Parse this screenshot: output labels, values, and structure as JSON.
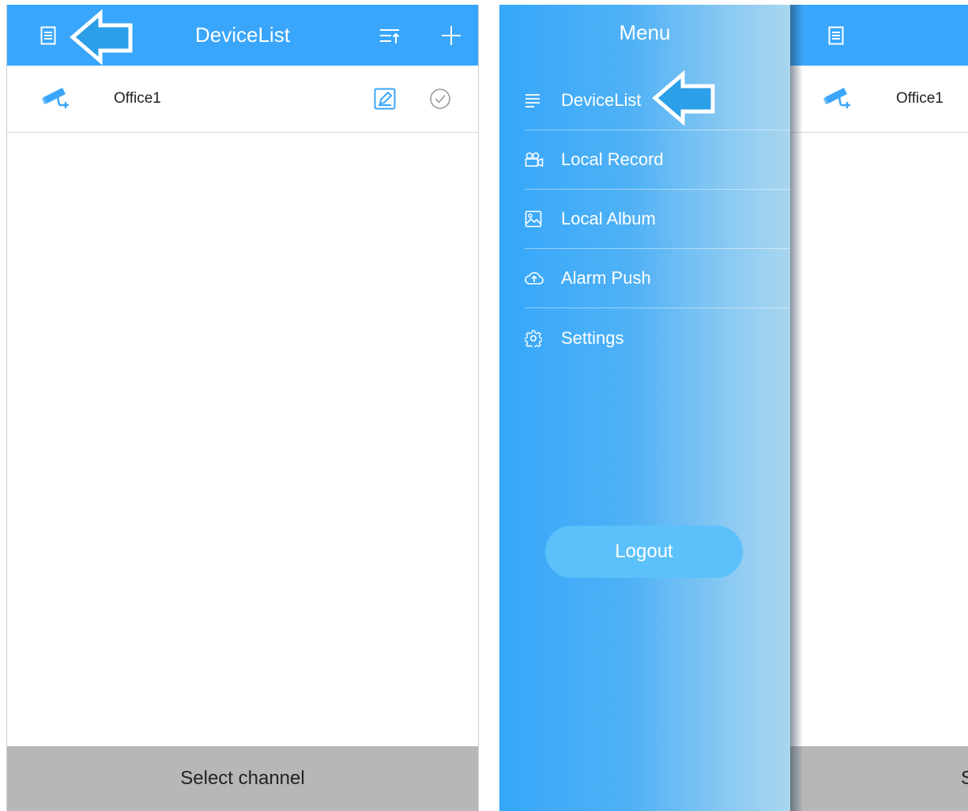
{
  "left_screen": {
    "title": "DeviceList",
    "device": {
      "name": "Office1"
    },
    "bottom_label": "Select channel",
    "icons": {
      "menu": "menu-document-icon",
      "sort": "sort-list-icon",
      "add": "plus-icon",
      "camera": "camera-icon",
      "edit": "edit-pencil-icon",
      "check": "check-circle-icon"
    }
  },
  "right_screen": {
    "menu_title": "Menu",
    "menu_items": [
      {
        "label": "DeviceList",
        "icon": "list-lines-icon"
      },
      {
        "label": "Local Record",
        "icon": "video-camera-icon"
      },
      {
        "label": "Local Album",
        "icon": "image-icon"
      },
      {
        "label": "Alarm Push",
        "icon": "cloud-upload-icon"
      },
      {
        "label": "Settings",
        "icon": "gear-icon"
      }
    ],
    "logout_label": "Logout",
    "device": {
      "name": "Office1"
    },
    "bottom_label_partial": "S"
  },
  "colors": {
    "accent": "#3aa6fb",
    "arrow": "#2b9fe8",
    "bottom_bar": "#b7b7b7"
  }
}
